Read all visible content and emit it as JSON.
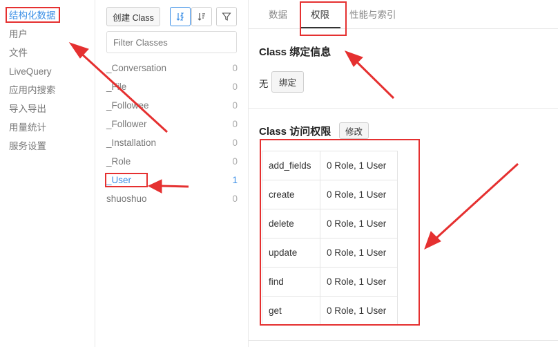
{
  "nav": {
    "items": [
      {
        "label": "结构化数据",
        "active": true
      },
      {
        "label": "用户"
      },
      {
        "label": "文件"
      },
      {
        "label": "LiveQuery"
      },
      {
        "label": "应用内搜索"
      },
      {
        "label": "导入导出"
      },
      {
        "label": "用量统计"
      },
      {
        "label": "服务设置"
      }
    ]
  },
  "classes": {
    "create_label": "创建 Class",
    "filter_placeholder": "Filter Classes",
    "items": [
      {
        "name": "_Conversation",
        "count": "0"
      },
      {
        "name": "_File",
        "count": "0"
      },
      {
        "name": "_Followee",
        "count": "0"
      },
      {
        "name": "_Follower",
        "count": "0"
      },
      {
        "name": "_Installation",
        "count": "0"
      },
      {
        "name": "_Role",
        "count": "0"
      },
      {
        "name": "_User",
        "count": "1",
        "active": true
      },
      {
        "name": "shuoshuo",
        "count": "0"
      }
    ]
  },
  "tabs": [
    {
      "label": "数据"
    },
    {
      "label": "权限",
      "active": true
    },
    {
      "label": "性能与索引"
    }
  ],
  "binding": {
    "title": "Class 绑定信息",
    "value": "无",
    "button": "绑定"
  },
  "access": {
    "title": "Class 访问权限",
    "edit_button": "修改",
    "rows": [
      {
        "op": "add_fields",
        "perm": "0 Role, 1 User"
      },
      {
        "op": "create",
        "perm": "0 Role, 1 User"
      },
      {
        "op": "delete",
        "perm": "0 Role, 1 User"
      },
      {
        "op": "update",
        "perm": "0 Role, 1 User"
      },
      {
        "op": "find",
        "perm": "0 Role, 1 User"
      },
      {
        "op": "get",
        "perm": "0 Role, 1 User"
      }
    ]
  },
  "colors": {
    "accent": "#3a8ee6",
    "annotation": "#e53030"
  }
}
